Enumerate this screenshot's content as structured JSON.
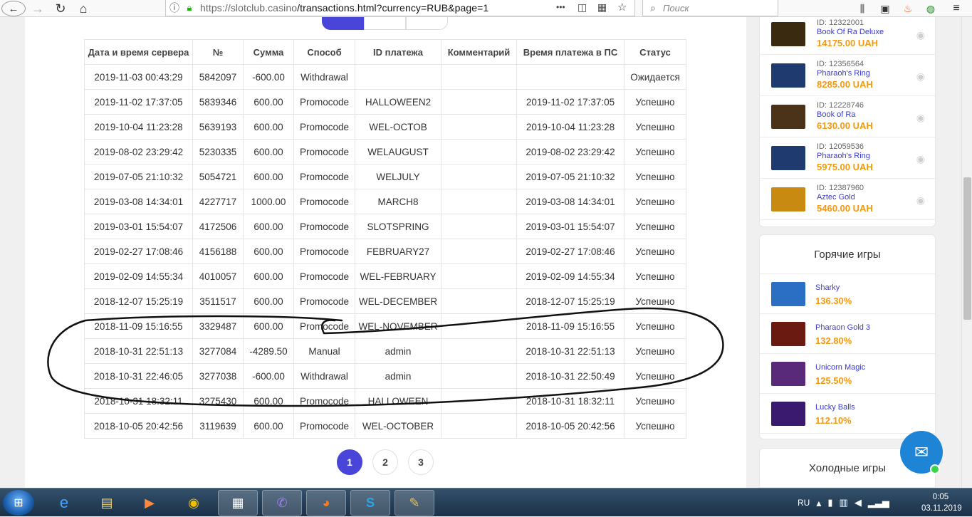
{
  "browser": {
    "url_host": "https://slotclub.casino",
    "url_path": "/transactions.html?currency=RUB&page=1",
    "search_placeholder": "Поиск",
    "more_label": "•••"
  },
  "table": {
    "headers": [
      "Дата и время сервера",
      "№",
      "Сумма",
      "Способ",
      "ID платежа",
      "Комментарий",
      "Время платежа в ПС",
      "Статус"
    ],
    "rows": [
      [
        "2019-11-03 00:43:29",
        "5842097",
        "-600.00",
        "Withdrawal",
        "",
        "",
        "",
        "Ожидается"
      ],
      [
        "2019-11-02 17:37:05",
        "5839346",
        "600.00",
        "Promocode",
        "HALLOWEEN2",
        "",
        "2019-11-02 17:37:05",
        "Успешно"
      ],
      [
        "2019-10-04 11:23:28",
        "5639193",
        "600.00",
        "Promocode",
        "WEL-OCTOB",
        "",
        "2019-10-04 11:23:28",
        "Успешно"
      ],
      [
        "2019-08-02 23:29:42",
        "5230335",
        "600.00",
        "Promocode",
        "WELAUGUST",
        "",
        "2019-08-02 23:29:42",
        "Успешно"
      ],
      [
        "2019-07-05 21:10:32",
        "5054721",
        "600.00",
        "Promocode",
        "WELJULY",
        "",
        "2019-07-05 21:10:32",
        "Успешно"
      ],
      [
        "2019-03-08 14:34:01",
        "4227717",
        "1000.00",
        "Promocode",
        "MARCH8",
        "",
        "2019-03-08 14:34:01",
        "Успешно"
      ],
      [
        "2019-03-01 15:54:07",
        "4172506",
        "600.00",
        "Promocode",
        "SLOTSPRING",
        "",
        "2019-03-01 15:54:07",
        "Успешно"
      ],
      [
        "2019-02-27 17:08:46",
        "4156188",
        "600.00",
        "Promocode",
        "FEBRUARY27",
        "",
        "2019-02-27 17:08:46",
        "Успешно"
      ],
      [
        "2019-02-09 14:55:34",
        "4010057",
        "600.00",
        "Promocode",
        "WEL-FEBRUARY",
        "",
        "2019-02-09 14:55:34",
        "Успешно"
      ],
      [
        "2018-12-07 15:25:19",
        "3511517",
        "600.00",
        "Promocode",
        "WEL-DECEMBER",
        "",
        "2018-12-07 15:25:19",
        "Успешно"
      ],
      [
        "2018-11-09 15:16:55",
        "3329487",
        "600.00",
        "Promocode",
        "WEL-NOVEMBER",
        "",
        "2018-11-09 15:16:55",
        "Успешно"
      ],
      [
        "2018-10-31 22:51:13",
        "3277084",
        "-4289.50",
        "Manual",
        "admin",
        "",
        "2018-10-31 22:51:13",
        "Успешно"
      ],
      [
        "2018-10-31 22:46:05",
        "3277038",
        "-600.00",
        "Withdrawal",
        "admin",
        "",
        "2018-10-31 22:50:49",
        "Успешно"
      ],
      [
        "2018-10-31 18:32:11",
        "3275430",
        "600.00",
        "Promocode",
        "HALLOWEEN",
        "",
        "2018-10-31 18:32:11",
        "Успешно"
      ],
      [
        "2018-10-05 20:42:56",
        "3119639",
        "600.00",
        "Promocode",
        "WEL-OCTOBER",
        "",
        "2018-10-05 20:42:56",
        "Успешно"
      ]
    ]
  },
  "pagination": {
    "pages": [
      "1",
      "2",
      "3"
    ],
    "current": "1"
  },
  "wins": [
    {
      "id": "ID: 12322001",
      "game": "Book Of Ra Deluxe",
      "amount": "14175.00 UAH",
      "thumb_color": "#3a2a10"
    },
    {
      "id": "ID: 12356564",
      "game": "Pharaoh's Ring",
      "amount": "8285.00 UAH",
      "thumb_color": "#1e3a6e"
    },
    {
      "id": "ID: 12228746",
      "game": "Book of Ra",
      "amount": "6130.00 UAH",
      "thumb_color": "#4a3318"
    },
    {
      "id": "ID: 12059536",
      "game": "Pharaoh's Ring",
      "amount": "5975.00 UAH",
      "thumb_color": "#1e3a6e"
    },
    {
      "id": "ID: 12387960",
      "game": "Aztec Gold",
      "amount": "5460.00 UAH",
      "thumb_color": "#c98a12"
    }
  ],
  "hot_games": {
    "title": "Горячие игры",
    "items": [
      {
        "name": "Sharky",
        "pct": "136.30%",
        "thumb_color": "#2a6fc4"
      },
      {
        "name": "Pharaon Gold 3",
        "pct": "132.80%",
        "thumb_color": "#6a1a10"
      },
      {
        "name": "Unicorn Magic",
        "pct": "125.50%",
        "thumb_color": "#5a2a7a"
      },
      {
        "name": "Lucky Balls",
        "pct": "112.10%",
        "thumb_color": "#3a1a6e"
      }
    ]
  },
  "cold_games": {
    "title": "Холодные игры"
  },
  "taskbar": {
    "lang": "RU",
    "time": "0:05",
    "date": "03.11.2019"
  },
  "colors": {
    "accent": "#4a45d9",
    "amount": "#f39a10",
    "link": "#3a3ad0"
  }
}
